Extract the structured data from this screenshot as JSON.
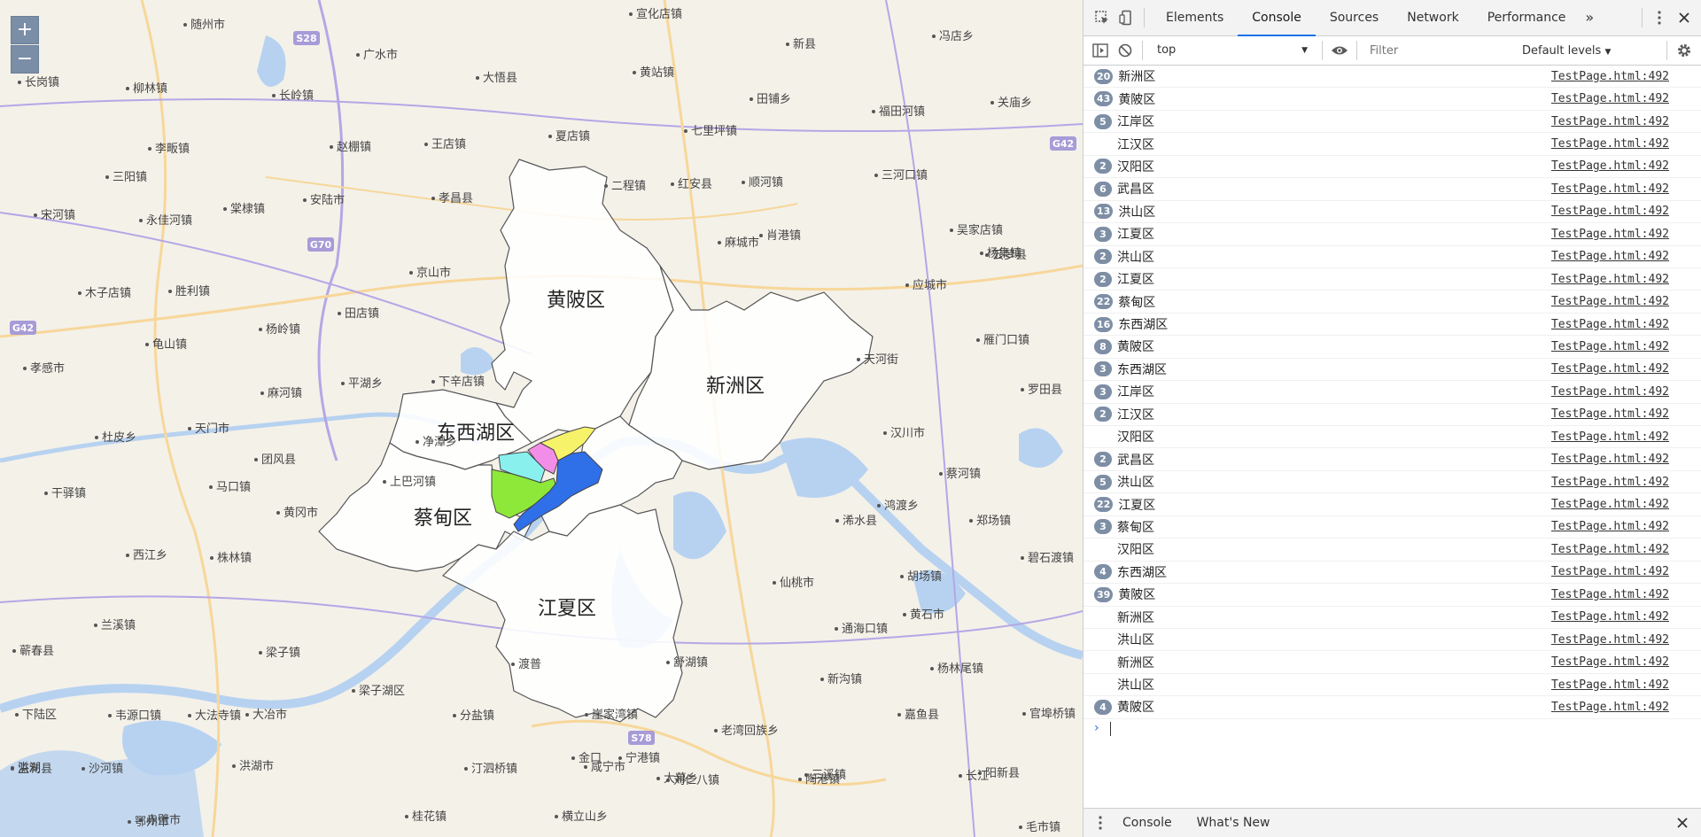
{
  "map": {
    "zoom_in": "+",
    "zoom_out": "−",
    "district_labels": [
      {
        "name": "黄陂区",
        "fill": "#ffffff"
      },
      {
        "name": "新洲区",
        "fill": "#ffffff"
      },
      {
        "name": "东西湖区",
        "fill": "#ffffff"
      },
      {
        "name": "蔡甸区",
        "fill": "#ffffff"
      },
      {
        "name": "江夏区",
        "fill": "#ffffff"
      }
    ],
    "place_labels": [
      "随州市",
      "广水市",
      "大悟县",
      "宣化店镇",
      "新县",
      "冯店乡",
      "长岗镇",
      "柳林镇",
      "长岭镇",
      "黄站镇",
      "田铺乡",
      "福田河镇",
      "关庙乡",
      "王店镇",
      "夏店镇",
      "七里坪镇",
      "李畈镇",
      "赵棚镇",
      "三阳镇",
      "棠棣镇",
      "安陆市",
      "孝昌县",
      "二程镇",
      "红安县",
      "顺河镇",
      "三河口镇",
      "吴家店镇",
      "杨集镇",
      "宋河镇",
      "永佳河镇",
      "麻城市",
      "木子店镇",
      "胜利镇",
      "京山市",
      "田店镇",
      "肖港镇",
      "云梦县",
      "龟山镇",
      "杨岭镇",
      "应城市",
      "孝感市",
      "平湖乡",
      "雁门口镇",
      "下辛店镇",
      "罗田县",
      "麻河镇",
      "天河街",
      "杜皮乡",
      "天门市",
      "净潭乡",
      "汉川市",
      "团风县",
      "上巴河镇",
      "鸿渡乡",
      "马口镇",
      "蔡河镇",
      "干驿镇",
      "黄冈市",
      "浠水县",
      "郑场镇",
      "西江乡",
      "株林镇",
      "胡场镇",
      "仙桃市",
      "碧石渡镇",
      "兰溪镇",
      "蕲春县",
      "梁子镇",
      "通海口镇",
      "黄石市",
      "新沟镇",
      "杨林尾镇",
      "下陆区",
      "韦源口镇",
      "大冶市",
      "分盐镇",
      "崖家湾镇",
      "老湾回族乡",
      "嘉鱼县",
      "官埠桥镇",
      "刘仁八镇",
      "陶港镇",
      "大法寺镇",
      "洪湖",
      "沙河镇",
      "洪湖市",
      "汀泗桥镇",
      "咸宁市",
      "大幕乡",
      "三溪镇",
      "阳新县",
      "监利县",
      "赤壁市",
      "桂花镇",
      "横立山乡",
      "毛市镇",
      "鄂州市",
      "长江",
      "梁子湖区",
      "舒湖镇",
      "渡普",
      "金口",
      "宁港镇"
    ],
    "road_shields": [
      "S28",
      "G70",
      "G42",
      "S78",
      "G42"
    ],
    "colors": {
      "hanyang": "#8ee83a",
      "qiaokou": "#8af0ee",
      "jiangan": "#f6f36a",
      "jianghan": "#f38ee8",
      "wuchang": "#2f6fe8",
      "bg": "#f4f1e9",
      "water": "#b7d2f0",
      "road_major": "#b4a7e6",
      "road_minor": "#f7d79a"
    }
  },
  "devtools": {
    "tabs": [
      "Elements",
      "Console",
      "Sources",
      "Network",
      "Performance"
    ],
    "active_tab": "Console",
    "more_tabs": "»",
    "context": "top",
    "filter_placeholder": "Filter",
    "levels": "Default levels",
    "log": [
      {
        "count": "20",
        "text": "新洲区",
        "src": "TestPage.html:492"
      },
      {
        "count": "43",
        "text": "黄陂区",
        "src": "TestPage.html:492"
      },
      {
        "count": "5",
        "text": "江岸区",
        "src": "TestPage.html:492"
      },
      {
        "count": "",
        "text": "江汉区",
        "src": "TestPage.html:492"
      },
      {
        "count": "2",
        "text": "汉阳区",
        "src": "TestPage.html:492"
      },
      {
        "count": "6",
        "text": "武昌区",
        "src": "TestPage.html:492"
      },
      {
        "count": "13",
        "text": "洪山区",
        "src": "TestPage.html:492"
      },
      {
        "count": "3",
        "text": "江夏区",
        "src": "TestPage.html:492"
      },
      {
        "count": "2",
        "text": "洪山区",
        "src": "TestPage.html:492"
      },
      {
        "count": "2",
        "text": "江夏区",
        "src": "TestPage.html:492"
      },
      {
        "count": "22",
        "text": "蔡甸区",
        "src": "TestPage.html:492"
      },
      {
        "count": "16",
        "text": "东西湖区",
        "src": "TestPage.html:492"
      },
      {
        "count": "8",
        "text": "黄陂区",
        "src": "TestPage.html:492"
      },
      {
        "count": "3",
        "text": "东西湖区",
        "src": "TestPage.html:492"
      },
      {
        "count": "3",
        "text": "江岸区",
        "src": "TestPage.html:492"
      },
      {
        "count": "2",
        "text": "江汉区",
        "src": "TestPage.html:492"
      },
      {
        "count": "",
        "text": "汉阳区",
        "src": "TestPage.html:492"
      },
      {
        "count": "2",
        "text": "武昌区",
        "src": "TestPage.html:492"
      },
      {
        "count": "5",
        "text": "洪山区",
        "src": "TestPage.html:492"
      },
      {
        "count": "22",
        "text": "江夏区",
        "src": "TestPage.html:492"
      },
      {
        "count": "3",
        "text": "蔡甸区",
        "src": "TestPage.html:492"
      },
      {
        "count": "",
        "text": "汉阳区",
        "src": "TestPage.html:492"
      },
      {
        "count": "4",
        "text": "东西湖区",
        "src": "TestPage.html:492"
      },
      {
        "count": "39",
        "text": "黄陂区",
        "src": "TestPage.html:492"
      },
      {
        "count": "",
        "text": "新洲区",
        "src": "TestPage.html:492"
      },
      {
        "count": "",
        "text": "洪山区",
        "src": "TestPage.html:492"
      },
      {
        "count": "",
        "text": "新洲区",
        "src": "TestPage.html:492"
      },
      {
        "count": "",
        "text": "洪山区",
        "src": "TestPage.html:492"
      },
      {
        "count": "4",
        "text": "黄陂区",
        "src": "TestPage.html:492"
      }
    ],
    "prompt": "›",
    "drawer_tabs": [
      "Console",
      "What's New"
    ]
  }
}
